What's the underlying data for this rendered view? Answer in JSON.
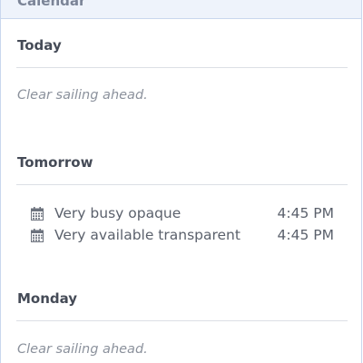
{
  "panel": {
    "title": "Calendar"
  },
  "sections": [
    {
      "heading": "Today",
      "empty_message": "Clear sailing ahead."
    },
    {
      "heading": "Tomorrow",
      "events": [
        {
          "title": "Very busy opaque",
          "time": "4:45 PM",
          "icon": "calendar-icon"
        },
        {
          "title": "Very available transparent",
          "time": "4:45 PM",
          "icon": "calendar-icon"
        }
      ]
    },
    {
      "heading": "Monday",
      "empty_message": "Clear sailing ahead."
    }
  ],
  "colors": {
    "header_background": "#eef3fb",
    "border": "#c9d7ee",
    "heading_text": "#454b57",
    "muted_text": "#8b919c"
  }
}
